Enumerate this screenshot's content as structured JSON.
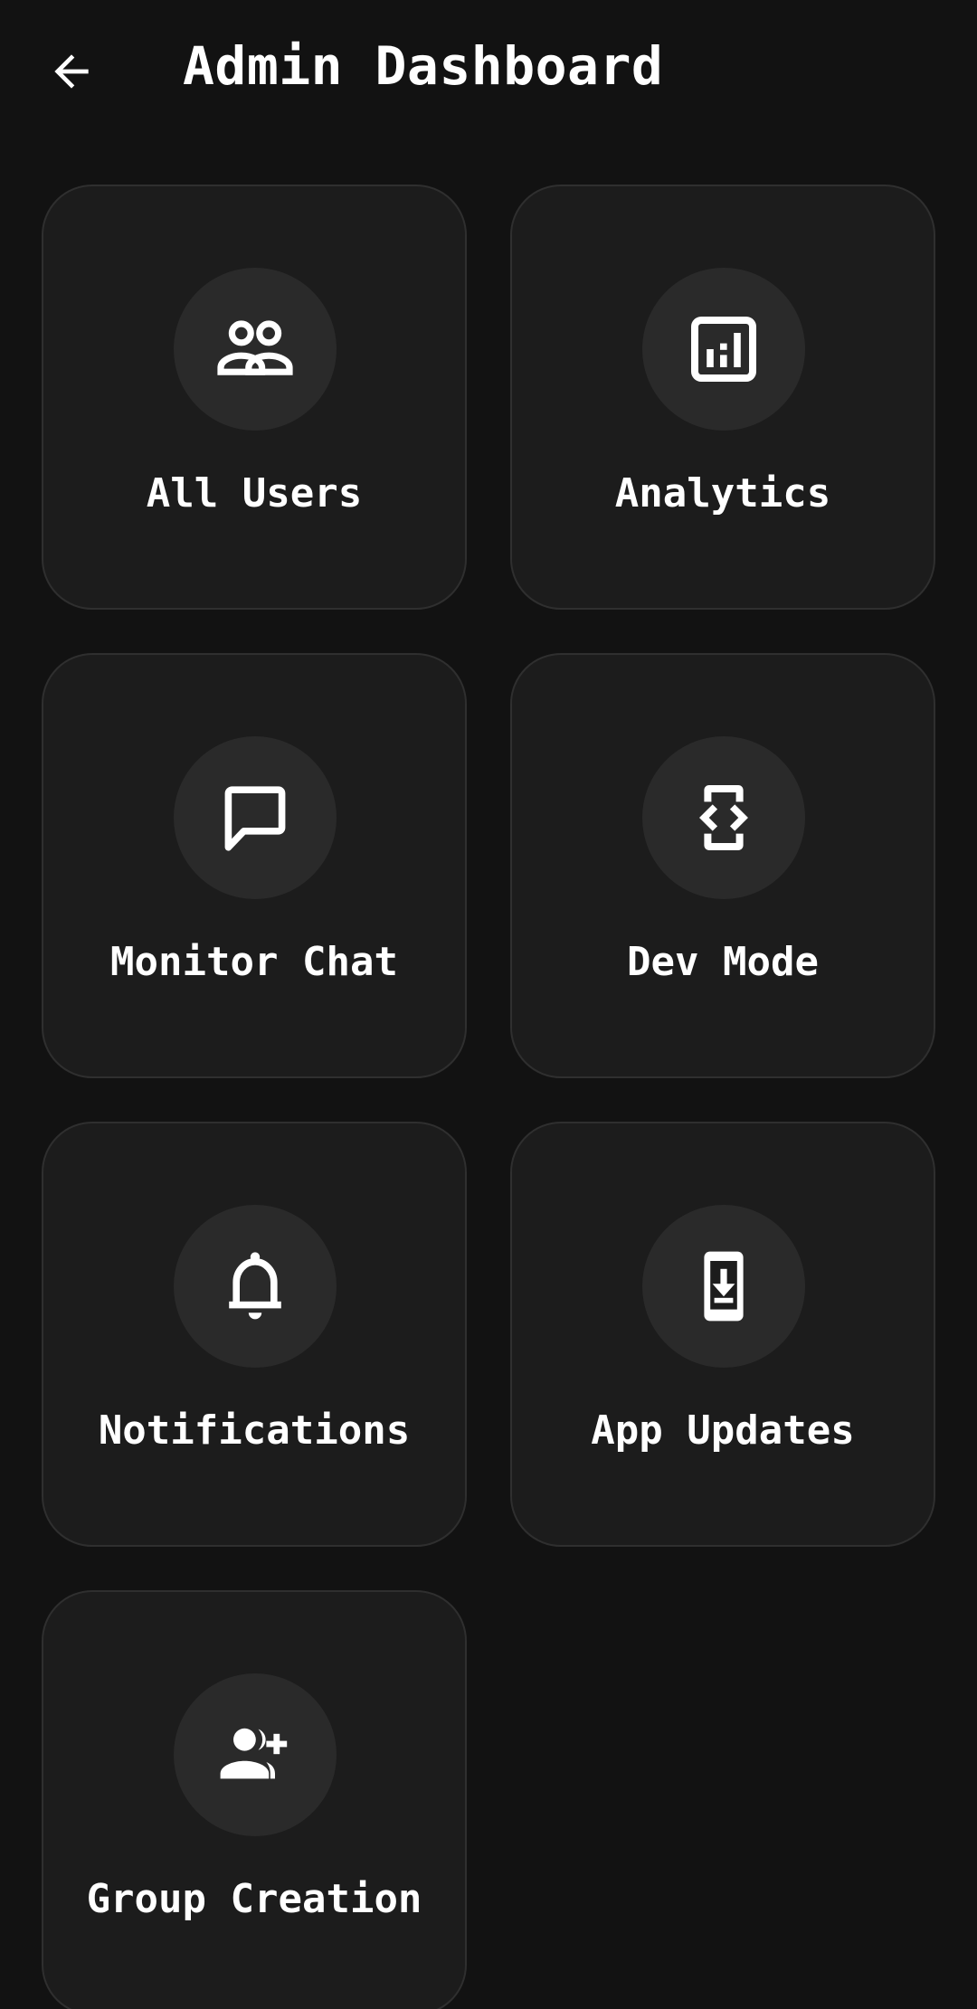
{
  "header": {
    "title": "Admin Dashboard",
    "back_icon": "arrow-back-icon"
  },
  "colors": {
    "background": "#121212",
    "card": "#1c1c1c",
    "card_border": "#2f2f2f",
    "icon_circle": "#2a2a2a",
    "text": "#ffffff"
  },
  "tiles": [
    {
      "label": "All Users",
      "icon": "users-icon"
    },
    {
      "label": "Analytics",
      "icon": "analytics-icon"
    },
    {
      "label": "Monitor Chat",
      "icon": "chat-icon"
    },
    {
      "label": "Dev Mode",
      "icon": "developer-mode-icon"
    },
    {
      "label": "Notifications",
      "icon": "bell-icon"
    },
    {
      "label": "App Updates",
      "icon": "system-update-icon"
    },
    {
      "label": "Group Creation",
      "icon": "group-add-icon"
    }
  ]
}
